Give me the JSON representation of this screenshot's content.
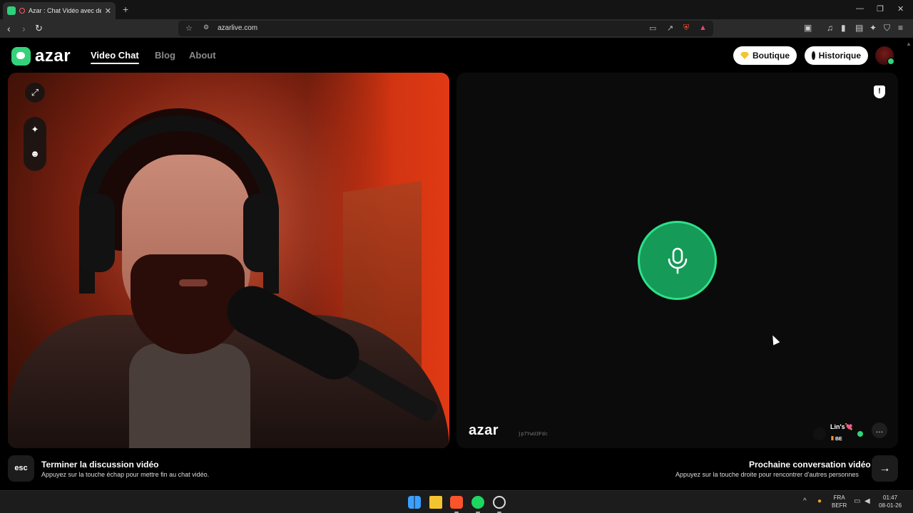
{
  "browser": {
    "tab_title": "Azar : Chat Vidéo avec de nouv",
    "url": "azarlive.com"
  },
  "header": {
    "logo_text": "azar",
    "nav": [
      {
        "label": "Video Chat",
        "active": true
      },
      {
        "label": "Blog",
        "active": false
      },
      {
        "label": "About",
        "active": false
      }
    ],
    "boutique_label": "Boutique",
    "historique_label": "Historique"
  },
  "remote": {
    "watermark": "azar",
    "watermark_id": "jp7YwU3Fdc",
    "peer_name": "Lin's💘",
    "peer_country": "BE"
  },
  "footer": {
    "esc_key": "esc",
    "end_title": "Terminer la discussion vidéo",
    "end_sub": "Appuyez sur la touche échap pour mettre fin au chat vidéo.",
    "next_title": "Prochaine conversation vidéo",
    "next_sub": "Appuyez sur la touche droite pour rencontrer d'autres personnes"
  },
  "taskbar": {
    "lang_top": "FRA",
    "lang_bottom": "BEFR",
    "time": "01:47",
    "date": "08-01-26"
  },
  "colors": {
    "accent_green": "#34d27b",
    "mic_green": "#159a57",
    "page_bg": "#000000"
  },
  "icons": [
    "expand-icon",
    "sparkle-icon",
    "face-filter-icon",
    "report-shield-icon",
    "microphone-icon",
    "chat-bubble-icon",
    "arrow-right-icon"
  ]
}
